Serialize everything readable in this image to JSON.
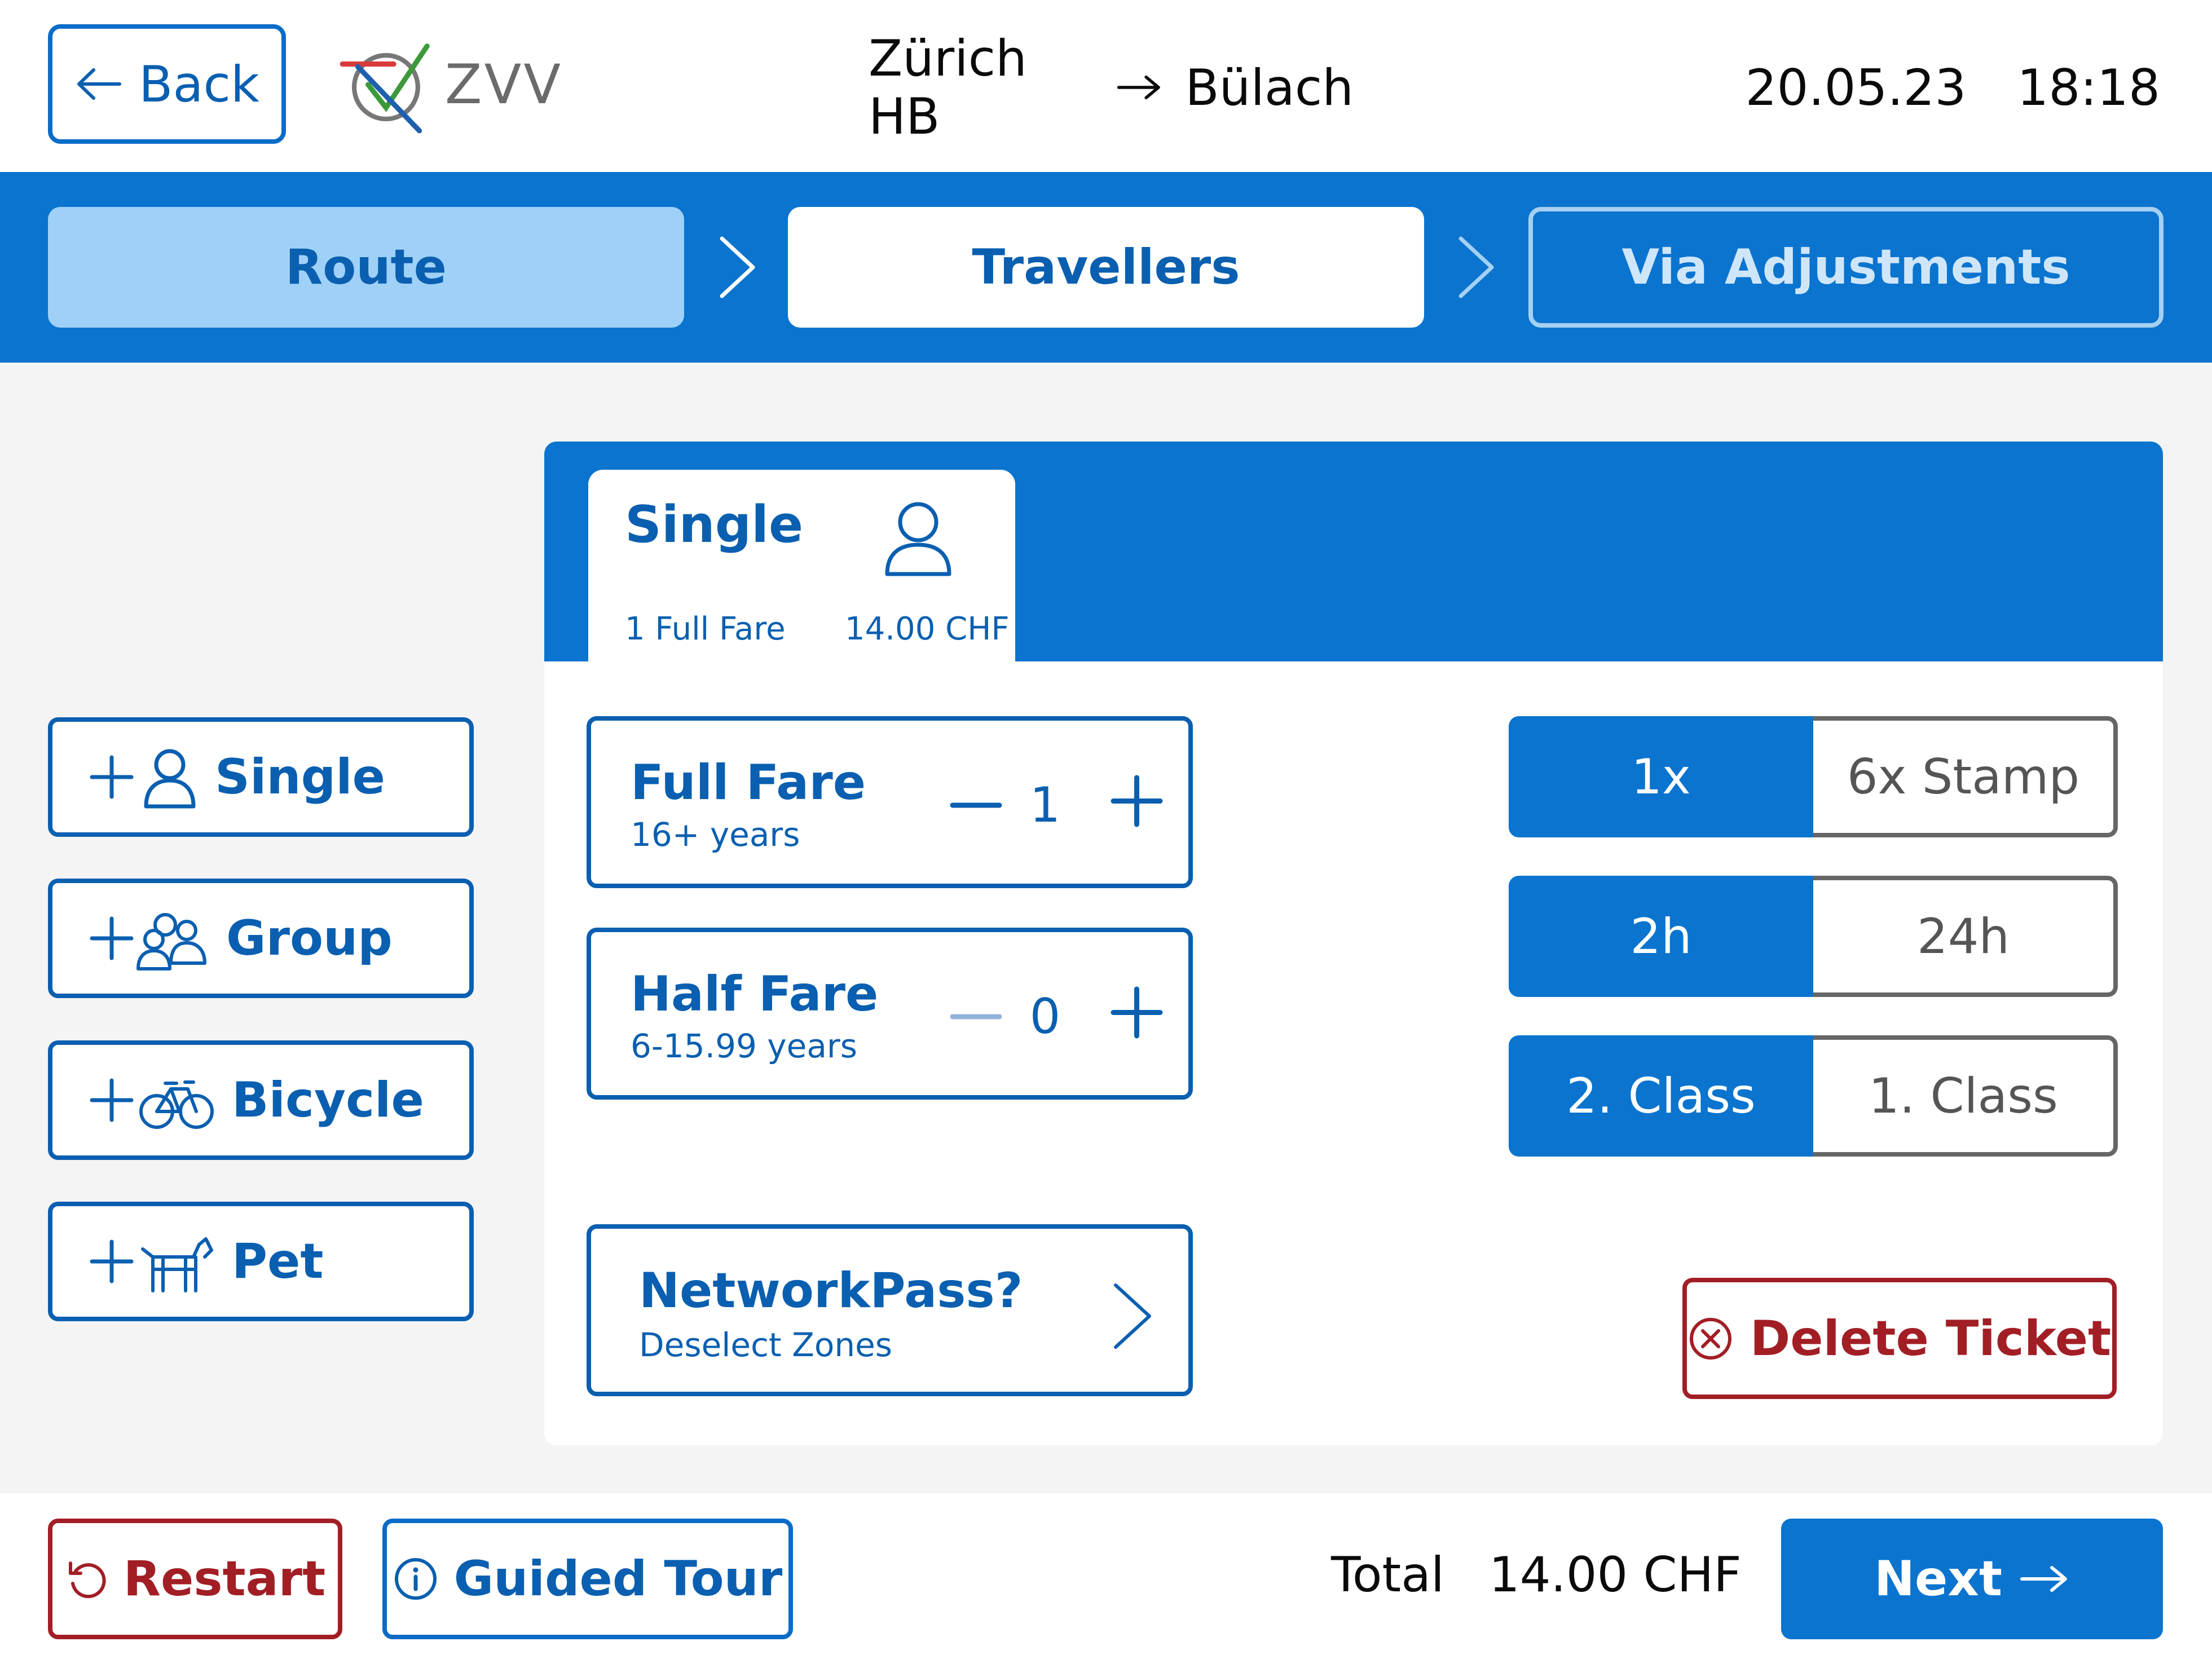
{
  "header": {
    "back_label": "Back",
    "logo_text": "ZVV",
    "origin": "Zürich HB",
    "destination": "Bülach",
    "date": "20.05.23",
    "time": "18:18"
  },
  "steps": [
    {
      "label": "Route",
      "state": "completed"
    },
    {
      "label": "Travellers",
      "state": "active"
    },
    {
      "label": "Via Adjustments",
      "state": "upcoming"
    }
  ],
  "add_buttons": [
    {
      "label": "Single",
      "icon": "add-person-icon"
    },
    {
      "label": "Group",
      "icon": "add-group-icon"
    },
    {
      "label": "Bicycle",
      "icon": "add-bicycle-icon"
    },
    {
      "label": "Pet",
      "icon": "add-pet-icon"
    }
  ],
  "ticket_tab": {
    "title": "Single",
    "fare_summary": "1 Full Fare",
    "price": "14.00 CHF",
    "icon": "person-icon"
  },
  "fares": [
    {
      "name": "Full Fare",
      "age": "16+ years",
      "count": "1",
      "minus_enabled": true
    },
    {
      "name": "Half Fare",
      "age": "6-15.99 years",
      "count": "0",
      "minus_enabled": false
    }
  ],
  "network_pass": {
    "title": "NetworkPass?",
    "subtitle": "Deselect Zones"
  },
  "options": {
    "trips": {
      "selected": "1x",
      "other": "6x Stamp"
    },
    "duration": {
      "selected": "2h",
      "other": "24h"
    },
    "class": {
      "selected": "2. Class",
      "other": "1. Class"
    }
  },
  "delete_label": "Delete Ticket",
  "footer": {
    "restart_label": "Restart",
    "tour_label": "Guided Tour",
    "total_label": "Total",
    "total_value": "14.00 CHF",
    "next_label": "Next"
  },
  "colors": {
    "primary": "#0a74cf",
    "primary_dark": "#0a5fb0",
    "completed_step": "#9fd1f8",
    "danger": "#a21e25",
    "background": "#f4f4f4"
  }
}
